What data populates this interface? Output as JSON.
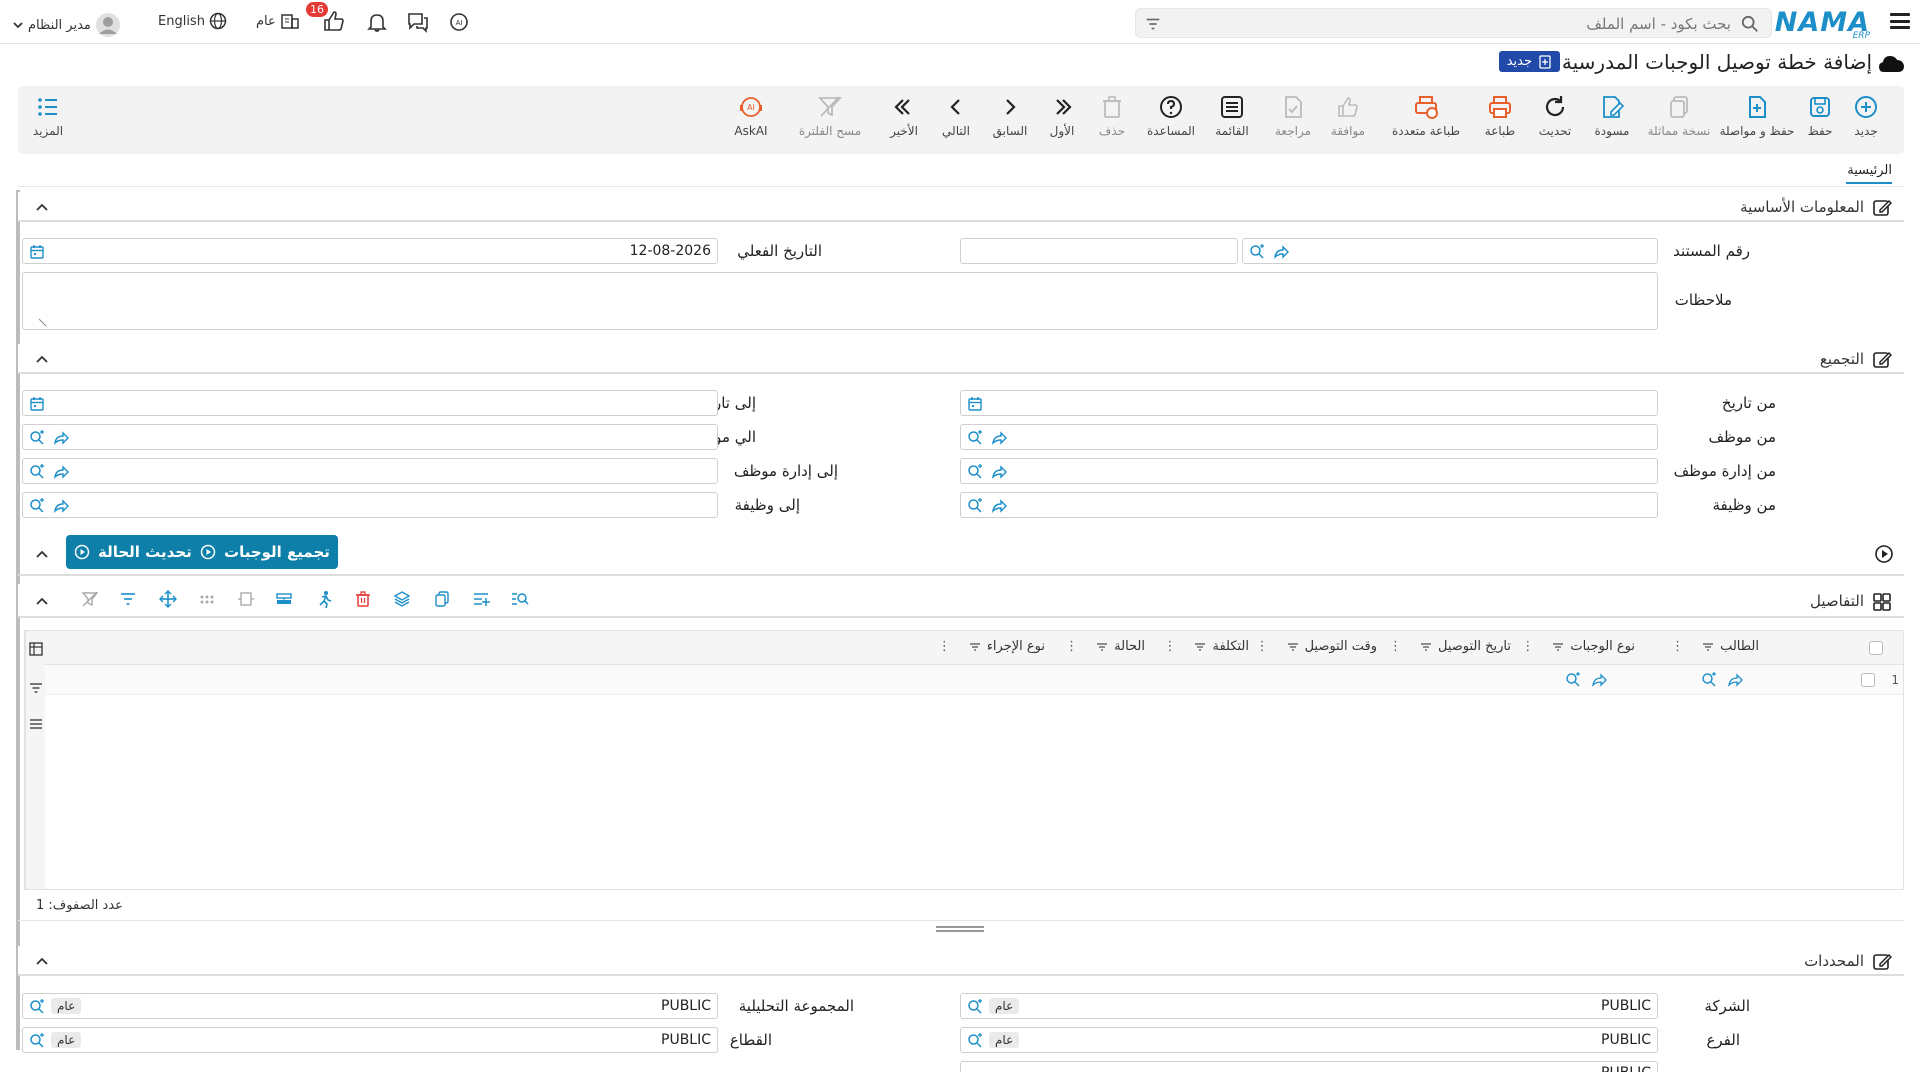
{
  "topbar": {
    "logo": "NAMA",
    "logo_sub": "ERP",
    "search_placeholder": "بحث بكود - اسم الملف",
    "language": "English",
    "user_name": "مدير النظام",
    "branch_label": "عام",
    "notification_count": "16"
  },
  "page": {
    "title": "إضافة خطة توصيل الوجبات المدرسية",
    "badge": "جديد"
  },
  "toolbar": {
    "items": [
      {
        "label": "جديد",
        "icon": "plus-circle-icon"
      },
      {
        "label": "حفظ",
        "icon": "save-icon"
      },
      {
        "label": "حفظ و مواصلة",
        "icon": "save-continue-icon"
      },
      {
        "label": "نسخة مماثلة",
        "icon": "copy-icon"
      },
      {
        "label": "مسودة",
        "icon": "draft-icon"
      },
      {
        "label": "تحديث",
        "icon": "refresh-icon"
      },
      {
        "label": "طباعة",
        "icon": "print-icon"
      },
      {
        "label": "طباعة متعددة",
        "icon": "multi-print-icon"
      },
      {
        "label": "موافقة",
        "icon": "approve-icon"
      },
      {
        "label": "مراجعة",
        "icon": "review-icon"
      },
      {
        "label": "القائمة",
        "icon": "list-icon"
      },
      {
        "label": "المساعدة",
        "icon": "help-icon"
      },
      {
        "label": "حذف",
        "icon": "trash-icon"
      },
      {
        "label": "الأول",
        "icon": "first-icon"
      },
      {
        "label": "السابق",
        "icon": "previous-icon"
      },
      {
        "label": "التالي",
        "icon": "next-icon"
      },
      {
        "label": "الأخير",
        "icon": "last-icon"
      },
      {
        "label": "مسح الفلترة",
        "icon": "clear-filter-icon"
      },
      {
        "label": "AskAI",
        "icon": "ask-ai-icon"
      }
    ],
    "more_label": "المزيد"
  },
  "tabs": {
    "main": "الرئيسية"
  },
  "basic_info": {
    "title": "المعلومات الأساسية",
    "doc_number_label": "رقم المستند",
    "doc_number_value": "",
    "actual_date_label": "التاريخ الفعلي",
    "actual_date_value": "12-08-2026",
    "notes_label": "ملاحظات"
  },
  "grouping": {
    "title": "التجميع",
    "from_date_label": "من تاريخ",
    "to_date_label": "إلى تاريخ",
    "from_employee_label": "من موظف",
    "to_employee_label": "الي موظف",
    "from_emp_dept_label": "من إدارة موظف",
    "to_emp_dept_label": "إلى إدارة موظف",
    "from_job_label": "من وظيفة",
    "to_job_label": "إلى وظيفة"
  },
  "actions": {
    "group_meals": "تجميع الوجبات",
    "update_status": "تحديث الحالة"
  },
  "details": {
    "title": "التفاصيل",
    "columns": [
      "الطالب",
      "نوع الوجبات",
      "تاريخ التوصيل",
      "وقت التوصيل",
      "التكلفة",
      "الحالة",
      "نوع الإجراء"
    ],
    "row_number": "1",
    "row_count_label": "عدد الصفوف: 1"
  },
  "dimensions": {
    "title": "المحددات",
    "company_label": "الشركة",
    "company_value": "PUBLIC",
    "company_tag": "عام",
    "analytic_group_label": "المجموعة التحليلية",
    "analytic_group_value": "PUBLIC",
    "analytic_group_tag": "عام",
    "branch_label": "الفرع",
    "branch_value": "PUBLIC",
    "branch_tag": "عام",
    "sector_label": "القطاع",
    "sector_value": "PUBLIC",
    "sector_tag": "عام",
    "partial_value": "PUBLIC"
  },
  "colors": {
    "accent": "#1c8fc9",
    "action_button": "#0e7fa8",
    "badge": "#2149a8",
    "print_orange": "#e8602c",
    "notification_red": "#e53935"
  }
}
